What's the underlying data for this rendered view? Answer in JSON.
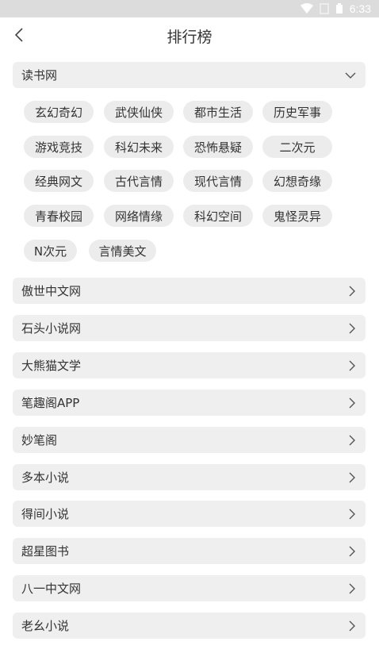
{
  "status": {
    "time": "6:33"
  },
  "header": {
    "title": "排行榜",
    "back_icon": "back-arrow-icon"
  },
  "expanded_section": {
    "label": "读书网",
    "icon": "chevron-down-icon",
    "categories": [
      "玄幻奇幻",
      "武侠仙侠",
      "都市生活",
      "历史军事",
      "游戏竞技",
      "科幻未来",
      "恐怖悬疑",
      "二次元",
      "经典网文",
      "古代言情",
      "现代言情",
      "幻想奇缘",
      "青春校园",
      "网络情缘",
      "科幻空间",
      "鬼怪灵异",
      "N次元",
      "言情美文"
    ]
  },
  "sources": [
    "傲世中文网",
    "石头小说网",
    "大熊猫文学",
    "笔趣阁APP",
    "妙笔阁",
    "多本小说",
    "得间小说",
    "超星图书",
    "八一中文网",
    "老幺小说"
  ],
  "colors": {
    "background": "#ffffff",
    "item_bg": "#efefef",
    "chip_bg": "#ececec",
    "text": "#333333"
  }
}
